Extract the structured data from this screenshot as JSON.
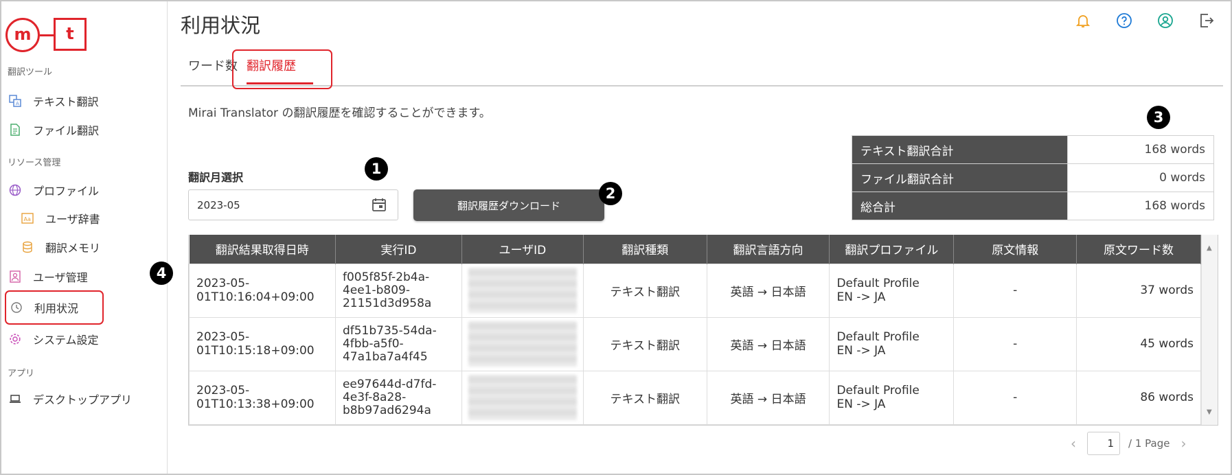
{
  "app": {
    "logo_m": "m",
    "logo_t": "t"
  },
  "sidebar": {
    "section_tools": "翻訳ツール",
    "section_resources": "リソース管理",
    "section_apps": "アプリ",
    "items": [
      {
        "label": "テキスト翻訳",
        "icon": "text-translate-icon"
      },
      {
        "label": "ファイル翻訳",
        "icon": "file-translate-icon"
      },
      {
        "label": "プロファイル",
        "icon": "globe-icon"
      },
      {
        "label": "ユーザ辞書",
        "icon": "dictionary-icon"
      },
      {
        "label": "翻訳メモリ",
        "icon": "database-icon"
      },
      {
        "label": "ユーザ管理",
        "icon": "user-management-icon"
      },
      {
        "label": "利用状況",
        "icon": "history-icon"
      },
      {
        "label": "システム設定",
        "icon": "gear-icon"
      },
      {
        "label": "デスクトップアプリ",
        "icon": "laptop-icon"
      }
    ]
  },
  "header": {
    "title": "利用状況"
  },
  "tabs": {
    "word_count": "ワード数",
    "history": "翻訳履歴"
  },
  "description": "Mirai Translator の翻訳履歴を確認することができます。",
  "markers": {
    "m1": "1",
    "m2": "2",
    "m3": "3",
    "m4": "4"
  },
  "month": {
    "label": "翻訳月選択",
    "value": "2023-05"
  },
  "download_button": "翻訳履歴ダウンロード",
  "summary": [
    {
      "label": "テキスト翻訳合計",
      "value": "168 words"
    },
    {
      "label": "ファイル翻訳合計",
      "value": "0 words"
    },
    {
      "label": "総合計",
      "value": "168 words"
    }
  ],
  "table": {
    "headers": [
      "翻訳結果取得日時",
      "実行ID",
      "ユーザID",
      "翻訳種類",
      "翻訳言語方向",
      "翻訳プロファイル",
      "原文情報",
      "原文ワード数"
    ],
    "rows": [
      {
        "datetime_1": "2023-05-",
        "datetime_2": "01T10:16:04+09:00",
        "id_1": "f005f85f-2b4a-",
        "id_2": "4ee1-b809-",
        "id_3": "21151d3d958a",
        "type": "テキスト翻訳",
        "direction": "英語 → 日本語",
        "profile_1": "Default Profile",
        "profile_2": "EN -> JA",
        "source": "-",
        "words": "37 words"
      },
      {
        "datetime_1": "2023-05-",
        "datetime_2": "01T10:15:18+09:00",
        "id_1": "df51b735-54da-",
        "id_2": "4fbb-a5f0-",
        "id_3": "47a1ba7a4f45",
        "type": "テキスト翻訳",
        "direction": "英語 → 日本語",
        "profile_1": "Default Profile",
        "profile_2": "EN -> JA",
        "source": "-",
        "words": "45 words"
      },
      {
        "datetime_1": "2023-05-",
        "datetime_2": "01T10:13:38+09:00",
        "id_1": "ee97644d-d7fd-",
        "id_2": "4e3f-8a28-",
        "id_3": "b8b97ad6294a",
        "type": "テキスト翻訳",
        "direction": "英語 → 日本語",
        "profile_1": "Default Profile",
        "profile_2": "EN -> JA",
        "source": "-",
        "words": "86 words"
      }
    ]
  },
  "pager": {
    "current": "1",
    "total": "/ 1 Page"
  },
  "colors": {
    "accent": "#e0242b",
    "header_bg": "#505050"
  }
}
